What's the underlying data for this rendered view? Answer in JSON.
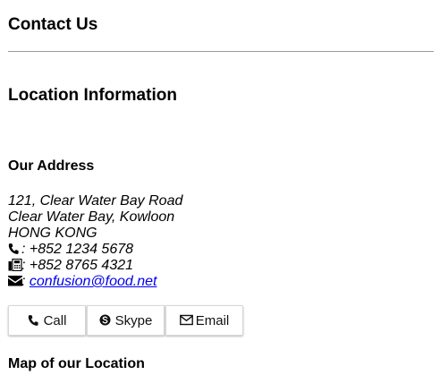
{
  "page": {
    "title": "Contact Us",
    "section_title": "Location Information"
  },
  "address": {
    "heading": "Our Address",
    "street": "121, Clear Water Bay Road",
    "district": "Clear Water Bay, Kowloon",
    "city": "HONG KONG",
    "phone": ": +852 1234 5678",
    "fax": ": +852 8765 4321",
    "email_sep": ": ",
    "email": "confusion@food.net"
  },
  "buttons": {
    "call": "Call",
    "skype": "Skype",
    "email": "Email"
  },
  "map": {
    "heading": "Map of our Location"
  },
  "icons": {
    "phone": "phone-icon",
    "fax": "fax-icon",
    "envelope": "envelope-icon",
    "skype": "skype-icon",
    "envelope_outline": "envelope-outline-icon"
  },
  "colors": {
    "link": "#0000ee",
    "divider": "#999999",
    "button_border": "#d8d8d8"
  }
}
